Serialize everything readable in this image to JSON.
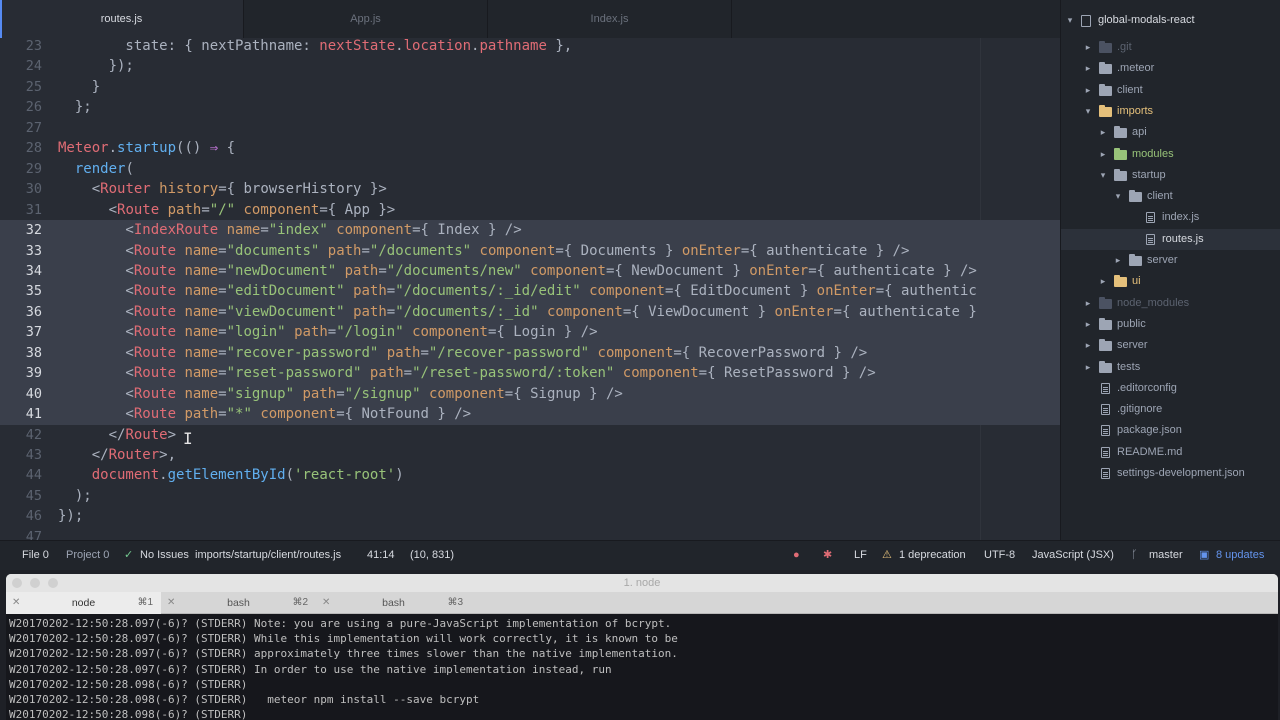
{
  "tabs": [
    {
      "label": "routes.js",
      "active": true
    },
    {
      "label": "App.js",
      "active": false
    },
    {
      "label": "Index.js",
      "active": false
    }
  ],
  "colors": {
    "keyword": "#c678dd",
    "function": "#61afef",
    "tag": "#e06c75",
    "attribute": "#d19a66",
    "string": "#98c379",
    "plain": "#abb2bf",
    "selection": "#3a3f4b",
    "accent": "#568af2"
  },
  "code_lines": [
    {
      "num": "23",
      "selected": false,
      "tokens": [
        [
          "pl",
          "        state: { nextPathname: "
        ],
        [
          "pr",
          "nextState"
        ],
        [
          "pl",
          "."
        ],
        [
          "pr",
          "location"
        ],
        [
          "pl",
          "."
        ],
        [
          "pr",
          "pathname"
        ],
        [
          "pl",
          " },"
        ]
      ]
    },
    {
      "num": "24",
      "selected": false,
      "tokens": [
        [
          "pl",
          "      });"
        ]
      ]
    },
    {
      "num": "25",
      "selected": false,
      "tokens": [
        [
          "pl",
          "    }"
        ]
      ]
    },
    {
      "num": "26",
      "selected": false,
      "tokens": [
        [
          "pl",
          "  };"
        ]
      ]
    },
    {
      "num": "27",
      "selected": false,
      "tokens": [
        [
          "pl",
          ""
        ]
      ]
    },
    {
      "num": "28",
      "selected": false,
      "tokens": [
        [
          "pr",
          "Meteor"
        ],
        [
          "pl",
          "."
        ],
        [
          "fn",
          "startup"
        ],
        [
          "pl",
          "(() "
        ],
        [
          "kw",
          "⇒"
        ],
        [
          "pl",
          " {"
        ]
      ]
    },
    {
      "num": "29",
      "selected": false,
      "tokens": [
        [
          "pl",
          "  "
        ],
        [
          "fn",
          "render"
        ],
        [
          "pl",
          "("
        ]
      ]
    },
    {
      "num": "30",
      "selected": false,
      "tokens": [
        [
          "pl",
          "    <"
        ],
        [
          "tg",
          "Router"
        ],
        [
          "pl",
          " "
        ],
        [
          "at",
          "history"
        ],
        [
          "pl",
          "={ browserHistory }>"
        ]
      ]
    },
    {
      "num": "31",
      "selected": false,
      "tokens": [
        [
          "pl",
          "      <"
        ],
        [
          "tg",
          "Route"
        ],
        [
          "pl",
          " "
        ],
        [
          "at",
          "path"
        ],
        [
          "pl",
          "="
        ],
        [
          "st",
          "\"/\""
        ],
        [
          "pl",
          " "
        ],
        [
          "at",
          "component"
        ],
        [
          "pl",
          "={ App }>"
        ]
      ]
    },
    {
      "num": "32",
      "selected": true,
      "tokens": [
        [
          "pl",
          "        <"
        ],
        [
          "tg",
          "IndexRoute"
        ],
        [
          "pl",
          " "
        ],
        [
          "at",
          "name"
        ],
        [
          "pl",
          "="
        ],
        [
          "st",
          "\"index\""
        ],
        [
          "pl",
          " "
        ],
        [
          "at",
          "component"
        ],
        [
          "pl",
          "={ "
        ],
        [
          "pl",
          "Index"
        ],
        [
          "pl",
          " } />"
        ]
      ]
    },
    {
      "num": "33",
      "selected": true,
      "tokens": [
        [
          "pl",
          "        <"
        ],
        [
          "tg",
          "Route"
        ],
        [
          "pl",
          " "
        ],
        [
          "at",
          "name"
        ],
        [
          "pl",
          "="
        ],
        [
          "st",
          "\"documents\""
        ],
        [
          "pl",
          " "
        ],
        [
          "at",
          "path"
        ],
        [
          "pl",
          "="
        ],
        [
          "st",
          "\"/documents\""
        ],
        [
          "pl",
          " "
        ],
        [
          "at",
          "component"
        ],
        [
          "pl",
          "={ Documents } "
        ],
        [
          "at",
          "onEnter"
        ],
        [
          "pl",
          "={ authenticate } />"
        ]
      ]
    },
    {
      "num": "34",
      "selected": true,
      "tokens": [
        [
          "pl",
          "        <"
        ],
        [
          "tg",
          "Route"
        ],
        [
          "pl",
          " "
        ],
        [
          "at",
          "name"
        ],
        [
          "pl",
          "="
        ],
        [
          "st",
          "\"newDocument\""
        ],
        [
          "pl",
          " "
        ],
        [
          "at",
          "path"
        ],
        [
          "pl",
          "="
        ],
        [
          "st",
          "\"/documents/new\""
        ],
        [
          "pl",
          " "
        ],
        [
          "at",
          "component"
        ],
        [
          "pl",
          "={ NewDocument } "
        ],
        [
          "at",
          "onEnter"
        ],
        [
          "pl",
          "={ authenticate } />"
        ]
      ]
    },
    {
      "num": "35",
      "selected": true,
      "tokens": [
        [
          "pl",
          "        <"
        ],
        [
          "tg",
          "Route"
        ],
        [
          "pl",
          " "
        ],
        [
          "at",
          "name"
        ],
        [
          "pl",
          "="
        ],
        [
          "st",
          "\"editDocument\""
        ],
        [
          "pl",
          " "
        ],
        [
          "at",
          "path"
        ],
        [
          "pl",
          "="
        ],
        [
          "st",
          "\"/documents/:_id/edit\""
        ],
        [
          "pl",
          " "
        ],
        [
          "at",
          "component"
        ],
        [
          "pl",
          "={ EditDocument } "
        ],
        [
          "at",
          "onEnter"
        ],
        [
          "pl",
          "={ authentic"
        ]
      ]
    },
    {
      "num": "36",
      "selected": true,
      "tokens": [
        [
          "pl",
          "        <"
        ],
        [
          "tg",
          "Route"
        ],
        [
          "pl",
          " "
        ],
        [
          "at",
          "name"
        ],
        [
          "pl",
          "="
        ],
        [
          "st",
          "\"viewDocument\""
        ],
        [
          "pl",
          " "
        ],
        [
          "at",
          "path"
        ],
        [
          "pl",
          "="
        ],
        [
          "st",
          "\"/documents/:_id\""
        ],
        [
          "pl",
          " "
        ],
        [
          "at",
          "component"
        ],
        [
          "pl",
          "={ ViewDocument } "
        ],
        [
          "at",
          "onEnter"
        ],
        [
          "pl",
          "={ authenticate }"
        ]
      ]
    },
    {
      "num": "37",
      "selected": true,
      "tokens": [
        [
          "pl",
          "        <"
        ],
        [
          "tg",
          "Route"
        ],
        [
          "pl",
          " "
        ],
        [
          "at",
          "name"
        ],
        [
          "pl",
          "="
        ],
        [
          "st",
          "\"login\""
        ],
        [
          "pl",
          " "
        ],
        [
          "at",
          "path"
        ],
        [
          "pl",
          "="
        ],
        [
          "st",
          "\"/login\""
        ],
        [
          "pl",
          " "
        ],
        [
          "at",
          "component"
        ],
        [
          "pl",
          "={ Login } />"
        ]
      ]
    },
    {
      "num": "38",
      "selected": true,
      "tokens": [
        [
          "pl",
          "        <"
        ],
        [
          "tg",
          "Route"
        ],
        [
          "pl",
          " "
        ],
        [
          "at",
          "name"
        ],
        [
          "pl",
          "="
        ],
        [
          "st",
          "\"recover-password\""
        ],
        [
          "pl",
          " "
        ],
        [
          "at",
          "path"
        ],
        [
          "pl",
          "="
        ],
        [
          "st",
          "\"/recover-password\""
        ],
        [
          "pl",
          " "
        ],
        [
          "at",
          "component"
        ],
        [
          "pl",
          "={ RecoverPassword } />"
        ]
      ]
    },
    {
      "num": "39",
      "selected": true,
      "tokens": [
        [
          "pl",
          "        <"
        ],
        [
          "tg",
          "Route"
        ],
        [
          "pl",
          " "
        ],
        [
          "at",
          "name"
        ],
        [
          "pl",
          "="
        ],
        [
          "st",
          "\"reset-password\""
        ],
        [
          "pl",
          " "
        ],
        [
          "at",
          "path"
        ],
        [
          "pl",
          "="
        ],
        [
          "st",
          "\"/reset-password/:token\""
        ],
        [
          "pl",
          " "
        ],
        [
          "at",
          "component"
        ],
        [
          "pl",
          "={ ResetPassword } />"
        ]
      ]
    },
    {
      "num": "40",
      "selected": true,
      "tokens": [
        [
          "pl",
          "        <"
        ],
        [
          "tg",
          "Route"
        ],
        [
          "pl",
          " "
        ],
        [
          "at",
          "name"
        ],
        [
          "pl",
          "="
        ],
        [
          "st",
          "\"signup\""
        ],
        [
          "pl",
          " "
        ],
        [
          "at",
          "path"
        ],
        [
          "pl",
          "="
        ],
        [
          "st",
          "\"/signup\""
        ],
        [
          "pl",
          " "
        ],
        [
          "at",
          "component"
        ],
        [
          "pl",
          "={ Signup } />"
        ]
      ]
    },
    {
      "num": "41",
      "selected": true,
      "tokens": [
        [
          "pl",
          "        <"
        ],
        [
          "tg",
          "Route"
        ],
        [
          "pl",
          " "
        ],
        [
          "at",
          "path"
        ],
        [
          "pl",
          "="
        ],
        [
          "st",
          "\"*\""
        ],
        [
          "pl",
          " "
        ],
        [
          "at",
          "component"
        ],
        [
          "pl",
          "={ NotFound } />"
        ]
      ]
    },
    {
      "num": "42",
      "selected": false,
      "tokens": [
        [
          "pl",
          "      </"
        ],
        [
          "tg",
          "Route"
        ],
        [
          "pl",
          ">"
        ]
      ]
    },
    {
      "num": "43",
      "selected": false,
      "tokens": [
        [
          "pl",
          "    </"
        ],
        [
          "tg",
          "Router"
        ],
        [
          "pl",
          ">,"
        ]
      ]
    },
    {
      "num": "44",
      "selected": false,
      "tokens": [
        [
          "pl",
          "    "
        ],
        [
          "pr",
          "document"
        ],
        [
          "pl",
          "."
        ],
        [
          "fn",
          "getElementById"
        ],
        [
          "pl",
          "("
        ],
        [
          "st",
          "'react-root'"
        ],
        [
          "pl",
          ")"
        ]
      ]
    },
    {
      "num": "45",
      "selected": false,
      "tokens": [
        [
          "pl",
          "  );"
        ]
      ]
    },
    {
      "num": "46",
      "selected": false,
      "tokens": [
        [
          "pl",
          "});"
        ]
      ]
    },
    {
      "num": "47",
      "selected": false,
      "tokens": [
        [
          "pl",
          ""
        ]
      ]
    }
  ],
  "tree": {
    "project": "global-modals-react",
    "items": [
      {
        "label": ".git",
        "kind": "folder",
        "style": "dim",
        "expanded": false
      },
      {
        "label": ".meteor",
        "kind": "folder",
        "style": "normal",
        "expanded": false
      },
      {
        "label": "client",
        "kind": "folder",
        "style": "normal",
        "expanded": false
      },
      {
        "label": "imports",
        "kind": "folder",
        "style": "open",
        "expanded": true
      },
      {
        "label": "api",
        "kind": "folder",
        "style": "normal",
        "expanded": false
      },
      {
        "label": "modules",
        "kind": "folder",
        "style": "green",
        "expanded": false
      },
      {
        "label": "startup",
        "kind": "folder",
        "style": "normal",
        "expanded": true
      },
      {
        "label": "client",
        "kind": "folder",
        "style": "normal",
        "expanded": true
      },
      {
        "label": "index.js",
        "kind": "file",
        "style": "normal"
      },
      {
        "label": "routes.js",
        "kind": "file",
        "style": "selected"
      },
      {
        "label": "server",
        "kind": "folder",
        "style": "normal",
        "expanded": false
      },
      {
        "label": "ui",
        "kind": "folder",
        "style": "open",
        "expanded": false
      },
      {
        "label": "node_modules",
        "kind": "folder",
        "style": "dim",
        "expanded": false
      },
      {
        "label": "public",
        "kind": "folder",
        "style": "normal",
        "expanded": false
      },
      {
        "label": "server",
        "kind": "folder",
        "style": "normal",
        "expanded": false
      },
      {
        "label": "tests",
        "kind": "folder",
        "style": "normal",
        "expanded": false
      },
      {
        "label": ".editorconfig",
        "kind": "file",
        "style": "normal"
      },
      {
        "label": ".gitignore",
        "kind": "file",
        "style": "normal"
      },
      {
        "label": "package.json",
        "kind": "file",
        "style": "normal"
      },
      {
        "label": "README.md",
        "kind": "file",
        "style": "normal"
      },
      {
        "label": "settings-development.json",
        "kind": "file",
        "style": "normal"
      }
    ]
  },
  "status": {
    "file": "File 0",
    "project": "Project 0",
    "issues": "No Issues",
    "path": "imports/startup/client/routes.js",
    "position": "41:14",
    "selection": "(10, 831)",
    "line_ending": "LF",
    "deprecation": "1 deprecation",
    "encoding": "UTF-8",
    "grammar": "JavaScript (JSX)",
    "branch": "master",
    "updates": "8 updates"
  },
  "terminal": {
    "title": "1. node",
    "tabs": [
      {
        "name": "node",
        "key": "⌘1",
        "active": true
      },
      {
        "name": "bash",
        "key": "⌘2",
        "active": false
      },
      {
        "name": "bash",
        "key": "⌘3",
        "active": false
      }
    ],
    "lines": [
      "W20170202-12:50:28.097(-6)? (STDERR) Note: you are using a pure-JavaScript implementation of bcrypt.",
      "W20170202-12:50:28.097(-6)? (STDERR) While this implementation will work correctly, it is known to be",
      "W20170202-12:50:28.097(-6)? (STDERR) approximately three times slower than the native implementation.",
      "W20170202-12:50:28.097(-6)? (STDERR) In order to use the native implementation instead, run",
      "W20170202-12:50:28.098(-6)? (STDERR)",
      "W20170202-12:50:28.098(-6)? (STDERR)   meteor npm install --save bcrypt",
      "W20170202-12:50:28.098(-6)? (STDERR)"
    ]
  }
}
